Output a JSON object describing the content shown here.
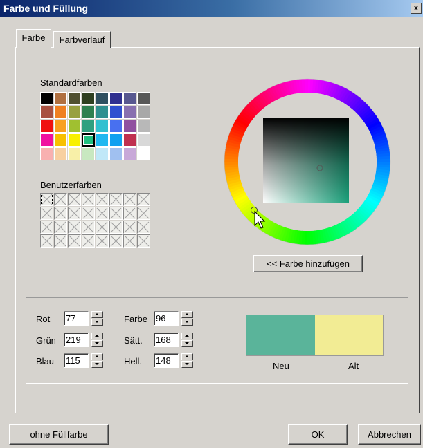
{
  "window": {
    "title": "Farbe und Füllung",
    "close_label": "x"
  },
  "tabs": [
    {
      "label": "Farbe",
      "active": true
    },
    {
      "label": "Farbverlauf",
      "active": false
    }
  ],
  "standard_colors": {
    "label": "Standardfarben",
    "selected_index": 27,
    "swatches": [
      "#000000",
      "#b07040",
      "#505030",
      "#304020",
      "#305060",
      "#303090",
      "#585890",
      "#585858",
      "#a85040",
      "#f08020",
      "#98a040",
      "#308050",
      "#309090",
      "#3050d0",
      "#8870b0",
      "#a8a8a8",
      "#f01010",
      "#f8a020",
      "#a0c030",
      "#30a080",
      "#30c0d0",
      "#4870f0",
      "#9050a0",
      "#b8b8b8",
      "#f010a0",
      "#f8c000",
      "#f8f000",
      "#20c080",
      "#20b8f0",
      "#10a0f0",
      "#c03050",
      "#d8d8d8",
      "#f8b0b0",
      "#f8d0a0",
      "#f8f0a8",
      "#c8e8c0",
      "#c0e8f8",
      "#a0c0f0",
      "#c8a8d8",
      "#ffffff"
    ]
  },
  "custom_colors": {
    "label": "Benutzerfarben",
    "count": 32
  },
  "add_color_button": "<< Farbe hinzufügen",
  "rgb": {
    "red": {
      "label": "Rot",
      "value": "77"
    },
    "green": {
      "label": "Grün",
      "value": "219"
    },
    "blue": {
      "label": "Blau",
      "value": "115"
    }
  },
  "hsl": {
    "hue": {
      "label": "Farbe",
      "value": "96"
    },
    "sat": {
      "label": "Sätt.",
      "value": "168"
    },
    "lum": {
      "label": "Hell.",
      "value": "148"
    }
  },
  "preview": {
    "new_label": "Neu",
    "old_label": "Alt",
    "new_color": "#5ab49a",
    "old_color": "#f2ec94"
  },
  "buttons": {
    "no_fill": "ohne Füllfarbe",
    "ok": "OK",
    "cancel": "Abbrechen"
  },
  "icons": {
    "cursor": "arrow-cursor-icon",
    "spin": "spin-arrows-icon"
  }
}
